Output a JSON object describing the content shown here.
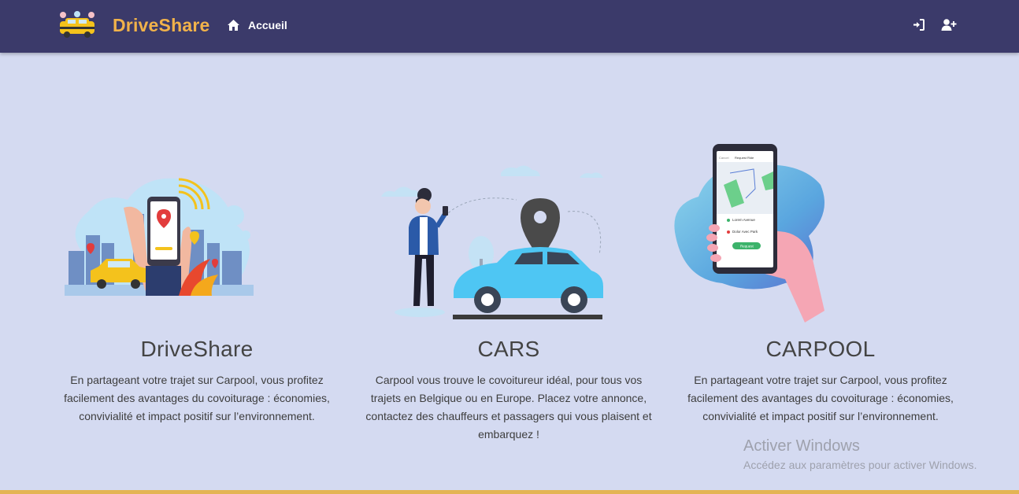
{
  "navbar": {
    "brand_name": "DriveShare",
    "home_label": "Accueil",
    "icons": {
      "home": "home-icon",
      "login": "sign-in-icon",
      "register": "user-plus-icon",
      "logo": "taxi-logo-icon"
    }
  },
  "cards": [
    {
      "title": "DriveShare",
      "text": "En partageant votre trajet sur Carpool, vous profitez facilement des avantages du covoiturage : économies, convivialité et impact positif sur l’environnement."
    },
    {
      "title": "CARS",
      "text": "Carpool vous trouve le covoitureur idéal, pour tous vos trajets en Belgique ou en Europe. Placez votre annonce, contactez des chauffeurs et passagers qui vous plaisent et embarquez !"
    },
    {
      "title": "CARPOOL",
      "text": "En partageant votre trajet sur Carpool, vous profitez facilement des avantages du covoiturage : économies, convivialité et impact positif sur l’environnement.",
      "phone_screen": {
        "header_left": "Cancel",
        "header_title": "Request Ride",
        "from": "Lorem Avenue",
        "to": "Dolor Avec Park",
        "button": "Request"
      }
    }
  ],
  "watermark": {
    "title": "Activer Windows",
    "subtitle": "Accédez aux paramètres pour activer Windows."
  },
  "colors": {
    "navbar": "#3b3a6a",
    "brand": "#f1b24a",
    "background": "#d4daf1",
    "bottom_bar": "#e4b454"
  }
}
